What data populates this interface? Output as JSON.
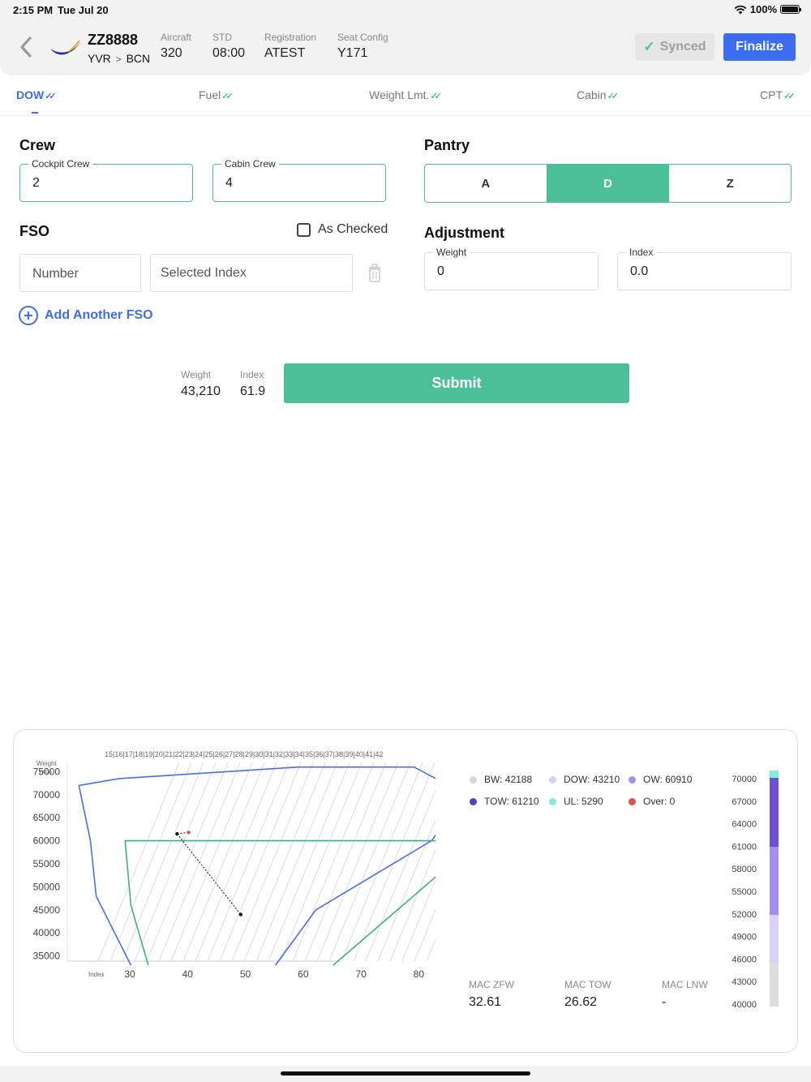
{
  "status": {
    "time": "2:15 PM",
    "date": "Tue Jul 20",
    "battery": "100%"
  },
  "header": {
    "flight_no": "ZZ8888",
    "origin": "YVR",
    "route_sep": ">",
    "destination": "BCN",
    "fields": [
      {
        "label": "Aircraft",
        "value": "320"
      },
      {
        "label": "STD",
        "value": "08:00"
      },
      {
        "label": "Registration",
        "value": "ATEST"
      },
      {
        "label": "Seat Config",
        "value": "Y171"
      }
    ],
    "synced_label": "Synced",
    "finalize_label": "Finalize"
  },
  "tabs": [
    {
      "label": "DOW",
      "active": true
    },
    {
      "label": "Fuel"
    },
    {
      "label": "Weight Lmt."
    },
    {
      "label": "Cabin"
    },
    {
      "label": "CPT"
    }
  ],
  "crew": {
    "title": "Crew",
    "cockpit_label": "Cockpit Crew",
    "cockpit_value": "2",
    "cabin_label": "Cabin Crew",
    "cabin_value": "4"
  },
  "fso": {
    "title": "FSO",
    "as_checked_label": "As Checked",
    "number_placeholder": "Number",
    "index_placeholder": "Selected Index",
    "add_label": "Add Another FSO"
  },
  "pantry": {
    "title": "Pantry",
    "options": [
      "A",
      "D",
      "Z"
    ],
    "selected": "D"
  },
  "adjustment": {
    "title": "Adjustment",
    "weight_label": "Weight",
    "weight_value": "0",
    "index_label": "Index",
    "index_value": "0.0"
  },
  "summary": {
    "weight_label": "Weight",
    "weight_value": "43,210",
    "index_label": "Index",
    "index_value": "61.9",
    "submit_label": "Submit"
  },
  "colors": {
    "accent": "#3b6cf2",
    "green": "#4bbf98",
    "envelope_blue": "#4a6ee8",
    "envelope_green": "#3fae86"
  },
  "chart_data": {
    "type": "scatter",
    "ylabel": "Weight",
    "ylabel_unit": "(KG)",
    "xlabel": "Index",
    "y_ticks": [
      75000,
      70000,
      65000,
      60000,
      55000,
      50000,
      45000,
      40000,
      35000
    ],
    "x_ticks": [
      30,
      40,
      50,
      60,
      70,
      80
    ],
    "top_scale": [
      "15",
      "16",
      "17",
      "18",
      "19",
      "20",
      "21",
      "22",
      "23",
      "24",
      "25",
      "26",
      "27",
      "28",
      "29",
      "30",
      "31",
      "32",
      "33",
      "34",
      "35",
      "36",
      "37",
      "38",
      "39",
      "40",
      "41",
      "42"
    ],
    "xlim": [
      22,
      85
    ],
    "ylim": [
      33000,
      77000
    ],
    "envelopes": [
      {
        "name": "envelope_blue",
        "points": [
          [
            33,
            33000
          ],
          [
            27,
            48000
          ],
          [
            26,
            60000
          ],
          [
            24,
            72000
          ],
          [
            31,
            73500
          ],
          [
            62,
            76000
          ],
          [
            82,
            76000
          ],
          [
            91,
            70000
          ],
          [
            85,
            60000
          ],
          [
            65,
            45000
          ],
          [
            58,
            33000
          ]
        ]
      },
      {
        "name": "envelope_green",
        "points": [
          [
            36,
            33000
          ],
          [
            33,
            46000
          ],
          [
            32,
            60000
          ],
          [
            93,
            60000
          ],
          [
            68,
            33000
          ]
        ]
      }
    ],
    "points": [
      {
        "x": 41,
        "y": 61500,
        "color": "#111111"
      },
      {
        "x": 43,
        "y": 61800,
        "color": "#e05a3a"
      },
      {
        "x": 52,
        "y": 44000,
        "color": "#111111"
      }
    ],
    "legend": [
      {
        "label": "BW: 42188",
        "color": "#d6d6d6"
      },
      {
        "label": "DOW: 43210",
        "color": "#d8d0f5"
      },
      {
        "label": "OW: 60910",
        "color": "#a48ff0"
      },
      {
        "label": "TOW: 61210",
        "color": "#5b3fbf"
      },
      {
        "label": "UL: 5290",
        "color": "#7ef0d8"
      },
      {
        "label": "Over: 0",
        "color": "#e0514a"
      }
    ],
    "bar_ticks": [
      "70000",
      "67000",
      "64000",
      "61000",
      "58000",
      "55000",
      "52000",
      "49000",
      "46000",
      "43000",
      "40000"
    ],
    "bar_segments": [
      {
        "name": "UL",
        "from": 70000,
        "to": 70700,
        "color": "#7ef0d8"
      },
      {
        "name": "TOW",
        "from": 61210,
        "to": 70000,
        "color": "#6b4fd0"
      },
      {
        "name": "OW",
        "from": 52000,
        "to": 61210,
        "color": "#a48ff0"
      },
      {
        "name": "DOW",
        "from": 45600,
        "to": 52000,
        "color": "#d8d0f5"
      },
      {
        "name": "BW",
        "from": 40000,
        "to": 45600,
        "color": "#dcdcdc"
      }
    ],
    "mac": [
      {
        "label": "MAC ZFW",
        "value": "32.61"
      },
      {
        "label": "MAC TOW",
        "value": "26.62"
      },
      {
        "label": "MAC LNW",
        "value": "-"
      }
    ]
  }
}
